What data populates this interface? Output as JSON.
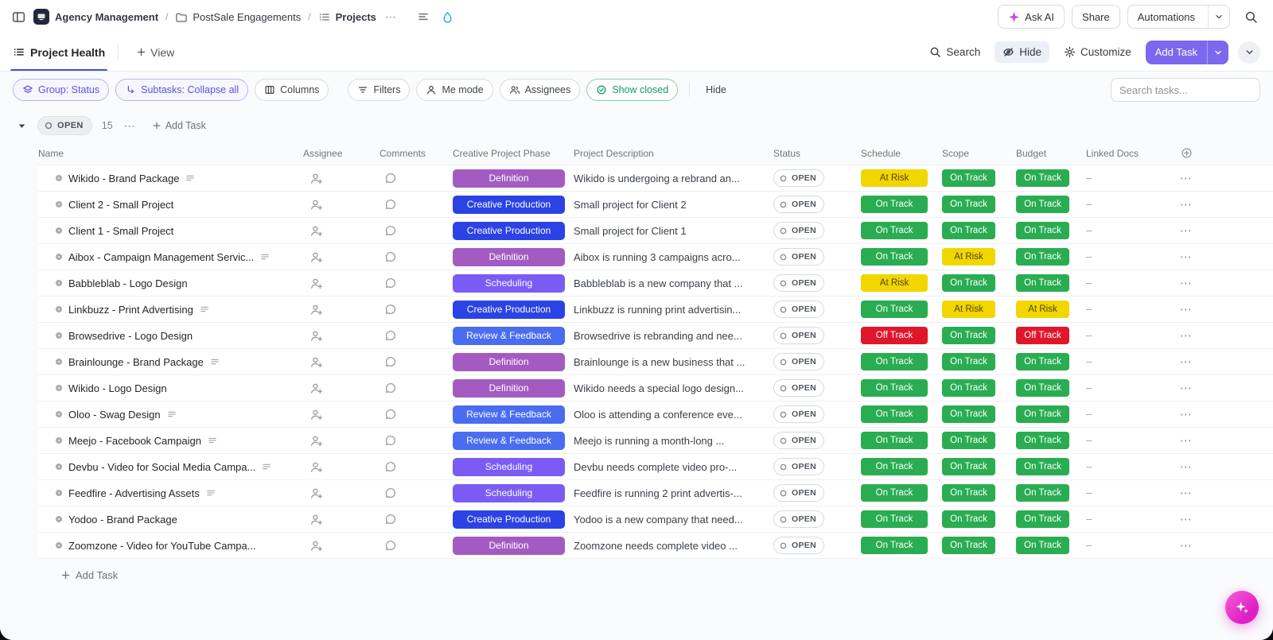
{
  "topbar": {
    "workspace": "Agency Management",
    "separator": "/",
    "folder": "PostSale Engagements",
    "list": "Projects",
    "ask_ai_label": "Ask AI",
    "share_label": "Share",
    "automations_label": "Automations"
  },
  "viewbar": {
    "view_name": "Project Health",
    "add_view_label": "View",
    "search_label": "Search",
    "hide_label": "Hide",
    "customize_label": "Customize",
    "add_task_label": "Add Task"
  },
  "toolbar": {
    "group_label": "Group: Status",
    "subtasks_label": "Subtasks: Collapse all",
    "columns_label": "Columns",
    "filters_label": "Filters",
    "me_mode_label": "Me mode",
    "assignees_label": "Assignees",
    "show_closed_label": "Show closed",
    "hide_label": "Hide",
    "search_placeholder": "Search tasks..."
  },
  "group_header": {
    "status": "OPEN",
    "count": "15",
    "add_task_label": "Add Task"
  },
  "table": {
    "columns": [
      "Name",
      "Assignee",
      "Comments",
      "Creative Project Phase",
      "Project Description",
      "Status",
      "Schedule",
      "Scope",
      "Budget",
      "Linked Docs"
    ],
    "rows": [
      {
        "name": "Wikido - Brand Package",
        "has_desc_icon": true,
        "phase": "Definition",
        "description": "Wikido is undergoing a rebrand an...",
        "status": "OPEN",
        "schedule": "At Risk",
        "scope": "On Track",
        "budget": "On Track",
        "linked_docs": "–"
      },
      {
        "name": "Client 2 - Small Project",
        "has_desc_icon": false,
        "phase": "Creative Production",
        "description": "Small project for Client 2",
        "status": "OPEN",
        "schedule": "On Track",
        "scope": "On Track",
        "budget": "On Track",
        "linked_docs": "–"
      },
      {
        "name": "Client 1 - Small Project",
        "has_desc_icon": false,
        "phase": "Creative Production",
        "description": "Small project for Client 1",
        "status": "OPEN",
        "schedule": "On Track",
        "scope": "On Track",
        "budget": "On Track",
        "linked_docs": "–"
      },
      {
        "name": "Aibox - Campaign Management Servic...",
        "has_desc_icon": true,
        "phase": "Definition",
        "description": "Aibox is running 3 campaigns acro...",
        "status": "OPEN",
        "schedule": "On Track",
        "scope": "At Risk",
        "budget": "On Track",
        "linked_docs": "–"
      },
      {
        "name": "Babbleblab - Logo Design",
        "has_desc_icon": false,
        "phase": "Scheduling",
        "description": "Babbleblab is a new company that ...",
        "status": "OPEN",
        "schedule": "At Risk",
        "scope": "On Track",
        "budget": "On Track",
        "linked_docs": "–"
      },
      {
        "name": "Linkbuzz - Print Advertising",
        "has_desc_icon": true,
        "phase": "Creative Production",
        "description": "Linkbuzz is running print advertisin...",
        "status": "OPEN",
        "schedule": "On Track",
        "scope": "At Risk",
        "budget": "At Risk",
        "linked_docs": "–"
      },
      {
        "name": "Browsedrive - Logo Design",
        "has_desc_icon": false,
        "phase": "Review & Feedback",
        "description": "Browsedrive is rebranding and nee...",
        "status": "OPEN",
        "schedule": "Off Track",
        "scope": "On Track",
        "budget": "Off Track",
        "linked_docs": "–"
      },
      {
        "name": "Brainlounge - Brand Package",
        "has_desc_icon": true,
        "phase": "Definition",
        "description": "Brainlounge is a new business that ...",
        "status": "OPEN",
        "schedule": "On Track",
        "scope": "On Track",
        "budget": "On Track",
        "linked_docs": "–"
      },
      {
        "name": "Wikido - Logo Design",
        "has_desc_icon": false,
        "phase": "Definition",
        "description": "Wikido needs a special logo design...",
        "status": "OPEN",
        "schedule": "On Track",
        "scope": "On Track",
        "budget": "On Track",
        "linked_docs": "–"
      },
      {
        "name": "Oloo - Swag Design",
        "has_desc_icon": true,
        "phase": "Review & Feedback",
        "description": "Oloo is attending a conference eve...",
        "status": "OPEN",
        "schedule": "On Track",
        "scope": "On Track",
        "budget": "On Track",
        "linked_docs": "–"
      },
      {
        "name": "Meejo - Facebook Campaign",
        "has_desc_icon": true,
        "phase": "Review & Feedback",
        "description": "Meejo is running a month-long ...",
        "status": "OPEN",
        "schedule": "On Track",
        "scope": "On Track",
        "budget": "On Track",
        "linked_docs": "–"
      },
      {
        "name": "Devbu - Video for Social Media Campa...",
        "has_desc_icon": true,
        "phase": "Scheduling",
        "description": "Devbu needs complete video pro-...",
        "status": "OPEN",
        "schedule": "On Track",
        "scope": "On Track",
        "budget": "On Track",
        "linked_docs": "–"
      },
      {
        "name": "Feedfire - Advertising Assets",
        "has_desc_icon": true,
        "phase": "Scheduling",
        "description": "Feedfire is running 2 print advertis-...",
        "status": "OPEN",
        "schedule": "On Track",
        "scope": "On Track",
        "budget": "On Track",
        "linked_docs": "–"
      },
      {
        "name": "Yodoo - Brand Package",
        "has_desc_icon": false,
        "phase": "Creative Production",
        "description": "Yodoo is a new company that need...",
        "status": "OPEN",
        "schedule": "On Track",
        "scope": "On Track",
        "budget": "On Track",
        "linked_docs": "–"
      },
      {
        "name": "Zoomzone - Video for YouTube Campa...",
        "has_desc_icon": false,
        "phase": "Definition",
        "description": "Zoomzone needs complete video ...",
        "status": "OPEN",
        "schedule": "On Track",
        "scope": "On Track",
        "budget": "On Track",
        "linked_docs": "–"
      }
    ]
  },
  "footer": {
    "add_task_label": "Add Task"
  },
  "misc": {
    "ellipsis": "⋯"
  },
  "colors": {
    "phase": {
      "Definition": "#A35BC2",
      "Creative Production": "#2B43E4",
      "Scheduling": "#7A5CF5",
      "Review & Feedback": "#4A6CF0"
    },
    "health": {
      "On Track": {
        "bg": "#2AAD52",
        "fg": "#FFFFFF"
      },
      "At Risk": {
        "bg": "#F2D600",
        "fg": "#4D4400"
      },
      "Off Track": {
        "bg": "#E0162B",
        "fg": "#FFFFFF"
      }
    },
    "accent_purple": "#7B68EE",
    "active_filter_purple": "#5A55E0",
    "show_closed_green": "#0F9C63",
    "tab_underline": "#4050D8",
    "ai_fab_pink": "#DF1FC4"
  }
}
